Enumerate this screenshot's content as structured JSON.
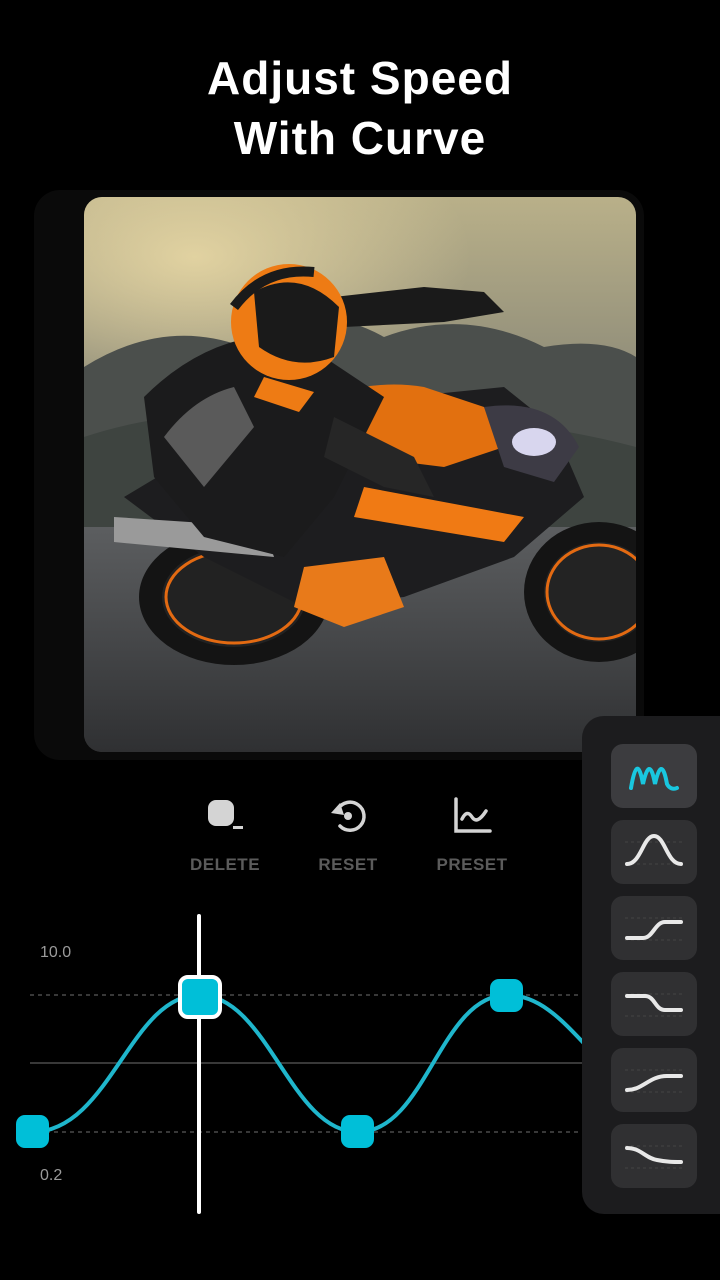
{
  "headline": {
    "line1": "Adjust Speed",
    "line2": "With Curve"
  },
  "photo": {
    "subject": "motorcycle rider leaning into a corner"
  },
  "toolbar": {
    "delete_label": "DELETE",
    "reset_label": "RESET",
    "preset_label": "PRESET"
  },
  "curve": {
    "max_label": "10.0",
    "min_label": "0.2",
    "accent_color": "#00bfd8",
    "points": [
      {
        "time": 0.0,
        "speed": "min"
      },
      {
        "time": 0.33,
        "speed": "max",
        "selected": true
      },
      {
        "time": 0.6,
        "speed": "min"
      },
      {
        "time": 0.85,
        "speed": "max"
      }
    ]
  },
  "presets": {
    "items": [
      {
        "name": "montage-curve-icon",
        "active": true
      },
      {
        "name": "hero-curve-icon",
        "active": false
      },
      {
        "name": "jump-cut-curve-icon",
        "active": false
      },
      {
        "name": "flash-in-curve-icon",
        "active": false
      },
      {
        "name": "flash-out-curve-icon",
        "active": false
      },
      {
        "name": "bullet-curve-icon",
        "active": false
      }
    ]
  }
}
